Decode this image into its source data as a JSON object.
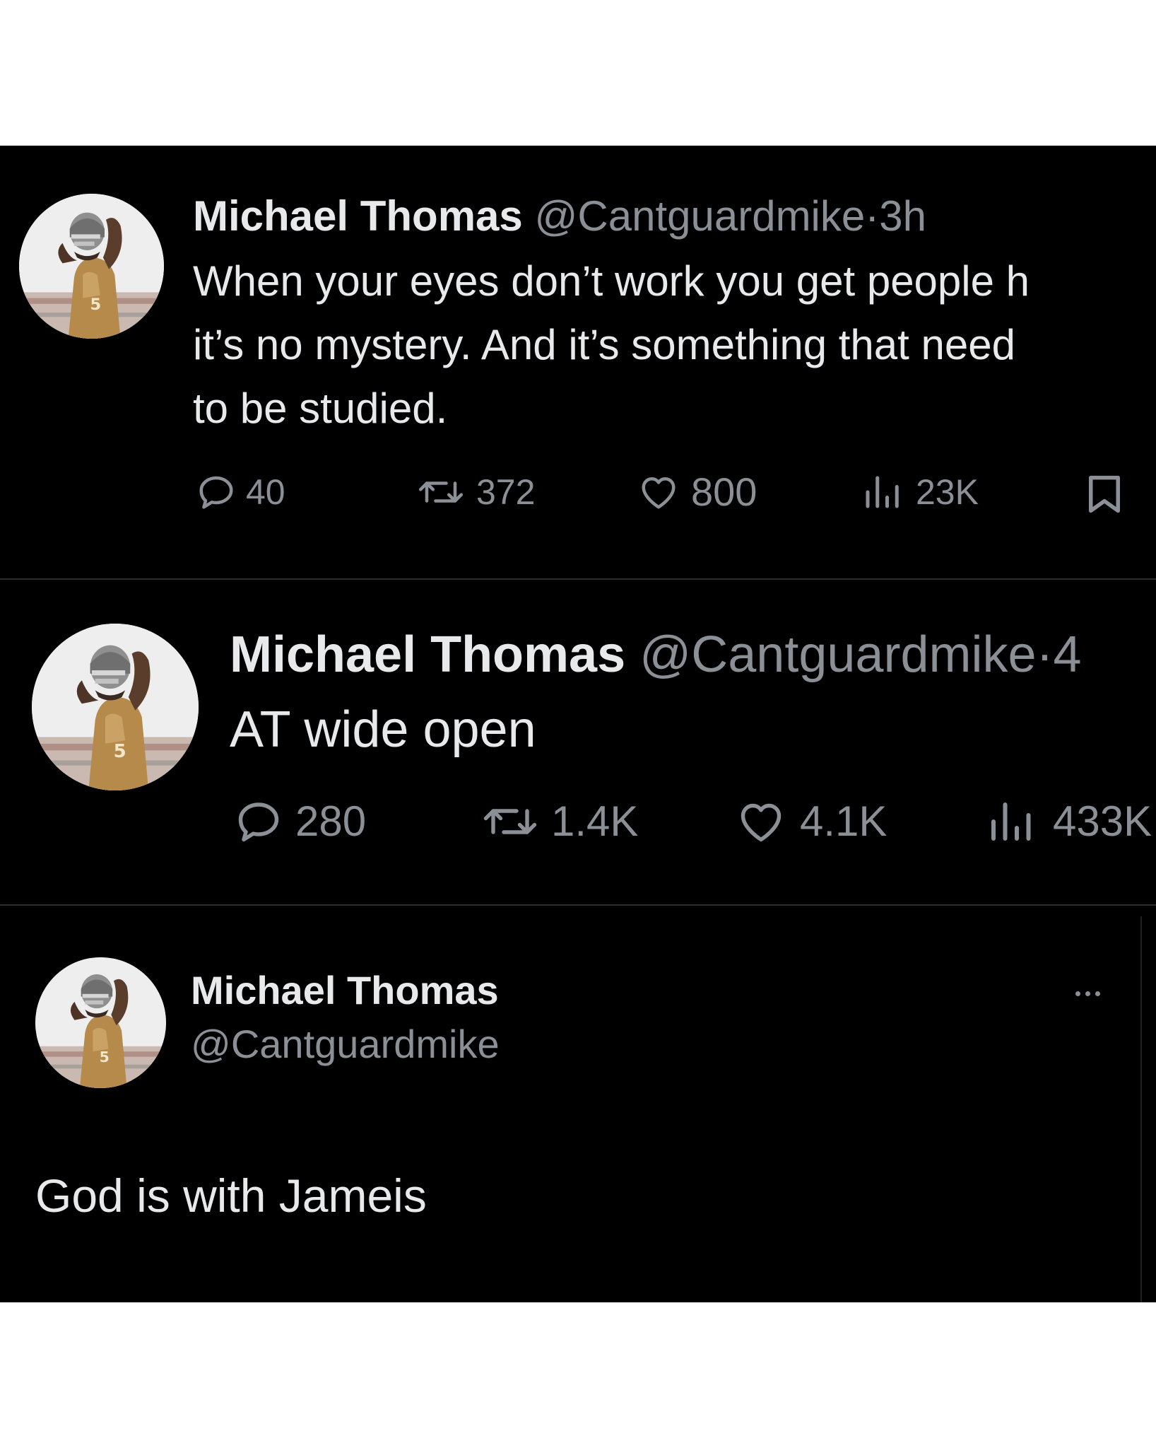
{
  "tweets": [
    {
      "name": "Michael Thomas",
      "handle": "@Cantguardmike",
      "separator": "·",
      "time": "3h",
      "text_lines": [
        "When your eyes don’t work you get people h",
        "it’s no mystery. And it’s something that need",
        "to be studied."
      ],
      "replies": "40",
      "reposts": "372",
      "likes": "800",
      "views": "23K"
    },
    {
      "name": "Michael Thomas",
      "handle": "@Cantguardmike",
      "separator": "·",
      "time": "4",
      "text_lines": [
        "AT wide open"
      ],
      "replies": "280",
      "reposts": "1.4K",
      "likes": "4.1K",
      "views": "433K"
    },
    {
      "name": "Michael Thomas",
      "handle": "@Cantguardmike",
      "text_lines": [
        "God is with Jameis"
      ]
    }
  ],
  "icons": {
    "reply": "reply-icon",
    "repost": "repost-icon",
    "like": "heart-icon",
    "views": "views-icon",
    "bookmark": "bookmark-icon",
    "more": "more-icon"
  },
  "colors": {
    "background": "#000000",
    "text": "#e7e9ea",
    "secondary": "#8b9096",
    "divider": "#2b2d31"
  }
}
